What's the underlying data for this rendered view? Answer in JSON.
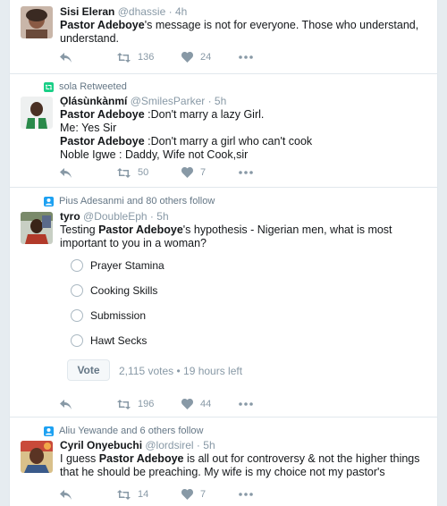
{
  "tweets": [
    {
      "name": "Sisi Eleran",
      "handle": "@dhassie",
      "dot": "·",
      "time": "4h",
      "text_before": "",
      "text_bold": "Pastor Adeboye",
      "text_after": "'s message is not for everyone. Those who understand, understand.",
      "retweets": "136",
      "likes": "24"
    },
    {
      "context": "sola Retweeted",
      "name": "Ọlásùnkànmí",
      "handle": "@SmilesParker",
      "dot": "·",
      "time": "5h",
      "lines": [
        {
          "bold": "Pastor Adeboye",
          "rest": " :Don't marry a lazy Girl."
        },
        {
          "bold": "",
          "rest": "Me: Yes Sir"
        },
        {
          "bold": "Pastor Adeboye",
          "rest": " :Don't marry a girl who can't cook"
        },
        {
          "bold": "",
          "rest": "Noble Igwe : Daddy, Wife not Cook,sir"
        }
      ],
      "retweets": "50",
      "likes": "7"
    },
    {
      "context": "Pius Adesanmi and 80 others follow",
      "name": "tyro",
      "handle": "@DoubleEph",
      "dot": "·",
      "time": "5h",
      "text_before": "Testing ",
      "text_bold": "Pastor Adeboye",
      "text_after": "'s hypothesis - Nigerian men, what is most important to you in a woman?",
      "poll_options": [
        "Prayer Stamina",
        "Cooking Skills",
        "Submission",
        "Hawt Secks"
      ],
      "vote_label": "Vote",
      "poll_meta": "2,115 votes • 19 hours left",
      "retweets": "196",
      "likes": "44"
    },
    {
      "context": "Aliu Yewande and 6 others follow",
      "name": "Cyril Onyebuchi",
      "handle": "@lordsirel",
      "dot": "·",
      "time": "5h",
      "text_before": "I guess ",
      "text_bold": "Pastor Adeboye",
      "text_after": " is all out for controversy & not the higher things that he should be preaching. My wife is my choice not my pastor's",
      "retweets": "14",
      "likes": "7"
    }
  ],
  "colors": {
    "retweet_context": "#19cf86",
    "follow_context": "#1da1f2",
    "icon_gray": "#8899a6",
    "border": "#e1e8ed"
  },
  "icons": [
    "reply-icon",
    "retweet-icon",
    "like-icon",
    "more-icon"
  ]
}
